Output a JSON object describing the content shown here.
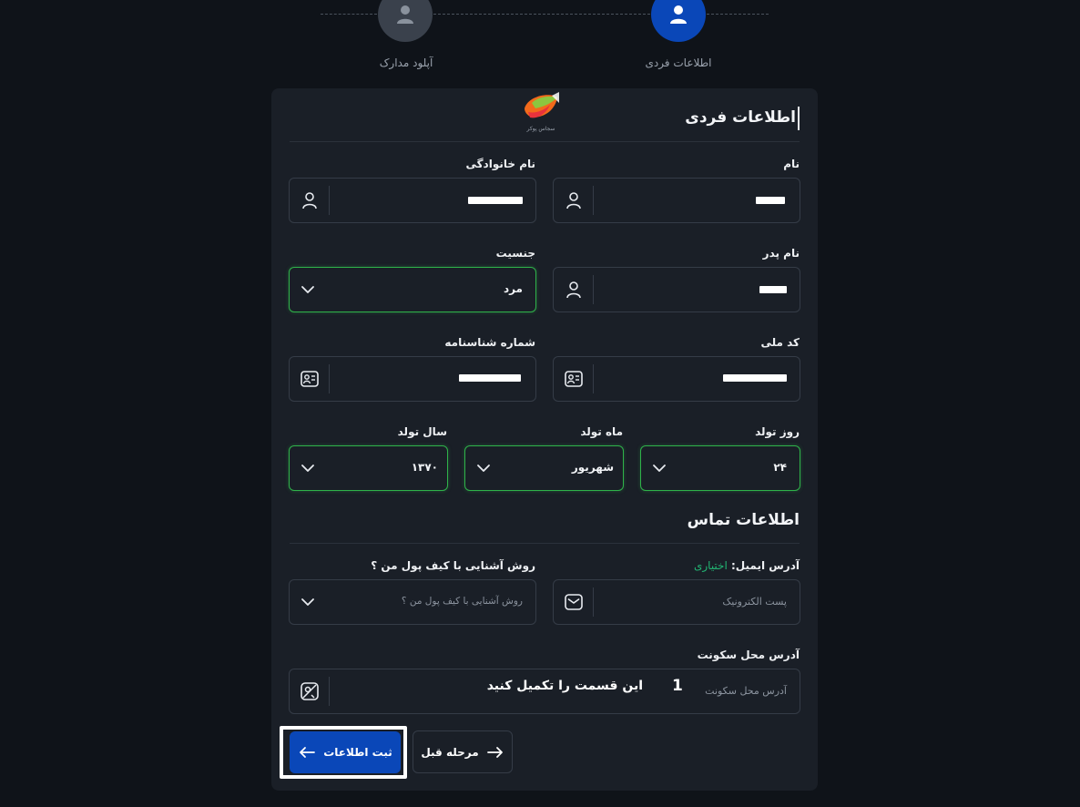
{
  "stepper": {
    "steps": [
      {
        "label": "آپلود مدارک",
        "state": "inactive",
        "icon": "user-icon"
      },
      {
        "label": "اطلاعات فردی",
        "state": "active",
        "icon": "user-icon"
      }
    ]
  },
  "logo": {
    "caption": "سجاس پوکر"
  },
  "personal": {
    "title": "اطلاعات فردی",
    "first_name": {
      "label": "نام",
      "icon": "user-icon"
    },
    "last_name": {
      "label": "نام خانوادگی",
      "icon": "user-icon"
    },
    "father_name": {
      "label": "نام پدر",
      "icon": "user-icon"
    },
    "gender": {
      "label": "جنسیت",
      "value": "مرد"
    },
    "national_code": {
      "label": "کد ملی",
      "icon": "id-card-icon"
    },
    "birth_cert": {
      "label": "شماره شناسنامه",
      "icon": "id-card-icon"
    },
    "birth_day": {
      "label": "روز تولد",
      "value": "۲۴"
    },
    "birth_month": {
      "label": "ماه تولد",
      "value": "شهریور"
    },
    "birth_year": {
      "label": "سال تولد",
      "value": "۱۳۷۰"
    }
  },
  "contact": {
    "title": "اطلاعات تماس",
    "email": {
      "label": "آدرس ایمیل:",
      "optional": "اختیاری",
      "placeholder": "پست الکترونیک",
      "icon": "mail-icon"
    },
    "referral": {
      "label": "روش آشنایی با کیف پول من ؟",
      "placeholder": "روش آشنایی با کیف پول من ؟"
    },
    "address": {
      "label": "آدرس محل سکونت",
      "placeholder": "آدرس محل سکونت",
      "icon": "map-icon",
      "hint_number": "1",
      "hint_text": "این قسمت را تکمیل کنید"
    }
  },
  "buttons": {
    "submit": "ثبت اطلاعات",
    "previous": "مرحله قبل"
  },
  "colors": {
    "background": "#0f1319",
    "card": "#1a1f27",
    "primary": "#0a47b8",
    "valid_border": "#2fb24a",
    "optional_text": "#22b573"
  }
}
